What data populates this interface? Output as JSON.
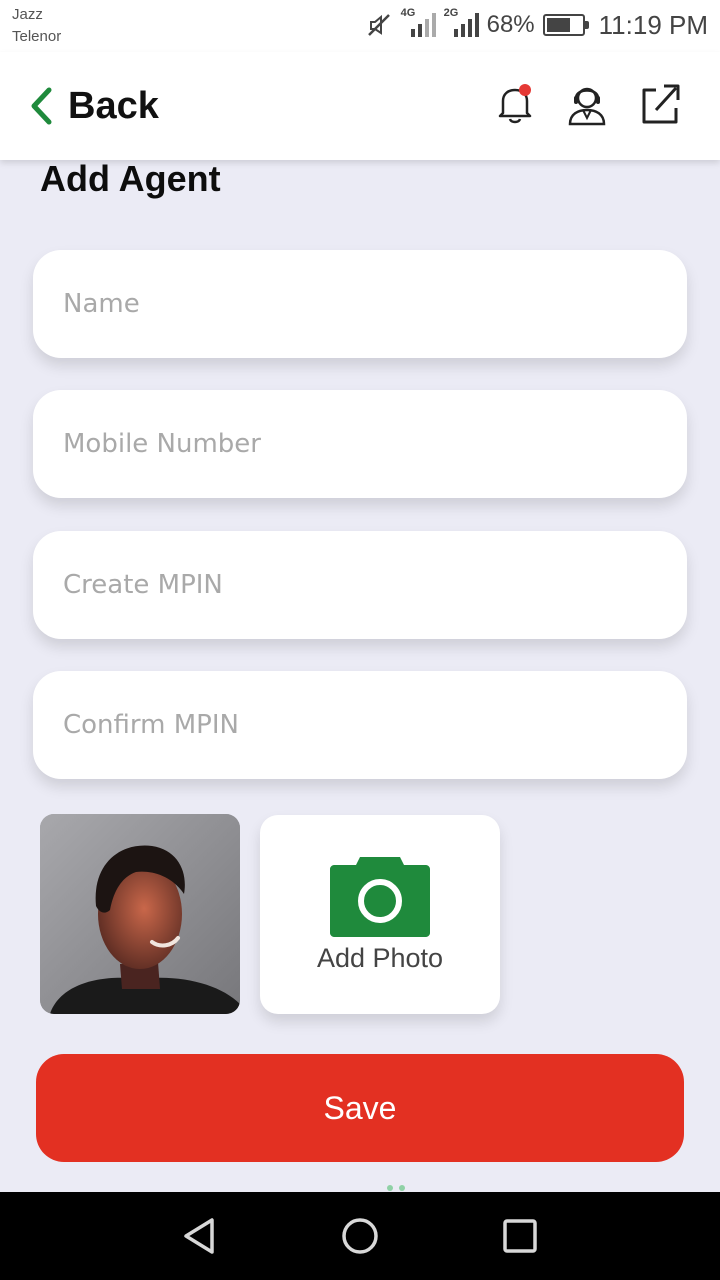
{
  "status_bar": {
    "carrier_1": "Jazz",
    "carrier_2": "Telenor",
    "network_1": "4G",
    "network_2": "2G",
    "battery_percent": "68%",
    "battery_level": 0.68,
    "time": "11:19 PM"
  },
  "header": {
    "back_label": "Back",
    "icons": [
      "notification-bell-icon",
      "support-agent-icon",
      "external-link-icon"
    ],
    "notification_dot_color": "#e53935",
    "back_chevron_color": "#1f8a3c"
  },
  "page": {
    "title": "Add Agent"
  },
  "form": {
    "name_placeholder": "Name",
    "mobile_placeholder": "Mobile Number",
    "create_mpin_placeholder": "Create MPIN",
    "confirm_mpin_placeholder": "Confirm MPIN",
    "add_photo_label": "Add Photo",
    "camera_icon_color": "#1f8a3c",
    "save_label": "Save",
    "save_color": "#e33022"
  },
  "nav": {
    "icons": [
      "back-triangle-icon",
      "home-circle-icon",
      "recents-square-icon"
    ]
  }
}
